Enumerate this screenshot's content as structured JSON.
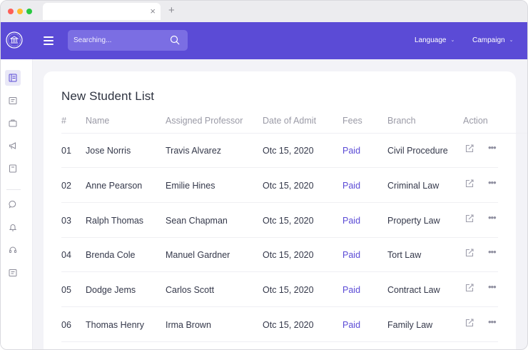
{
  "browser": {
    "tab_close": "×",
    "new_tab": "+"
  },
  "topbar": {
    "search_placeholder": "Searching...",
    "language_label": "Language",
    "campaign_label": "Campaign",
    "caret": "⌄",
    "accent_color": "#5b4bd6"
  },
  "sidebar": {
    "top_icons": [
      "dashboard-icon",
      "courses-icon",
      "briefcase-icon",
      "megaphone-icon",
      "book-icon"
    ],
    "bottom_icons": [
      "chat-icon",
      "bell-icon",
      "headset-icon",
      "courses-icon"
    ]
  },
  "students": {
    "title": "New Student List",
    "columns": [
      "#",
      "Name",
      "Assigned Professor",
      "Date of Admit",
      "Fees",
      "Branch",
      "Action"
    ],
    "rows": [
      {
        "num": "01",
        "name": "Jose Norris",
        "professor": "Travis Alvarez",
        "date": "Otc 15, 2020",
        "fees": "Paid",
        "branch": "Civil Procedure"
      },
      {
        "num": "02",
        "name": "Anne Pearson",
        "professor": "Emilie Hines",
        "date": "Otc 15, 2020",
        "fees": "Paid",
        "branch": "Criminal Law"
      },
      {
        "num": "03",
        "name": "Ralph Thomas",
        "professor": "Sean Chapman",
        "date": "Otc 15, 2020",
        "fees": "Paid",
        "branch": "Property Law"
      },
      {
        "num": "04",
        "name": "Brenda Cole",
        "professor": "Manuel Gardner",
        "date": "Otc 15, 2020",
        "fees": "Paid",
        "branch": "Tort Law"
      },
      {
        "num": "05",
        "name": "Dodge Jems",
        "professor": "Carlos Scott",
        "date": "Otc 15, 2020",
        "fees": "Paid",
        "branch": "Contract Law"
      },
      {
        "num": "06",
        "name": "Thomas Henry",
        "professor": "Irma Brown",
        "date": "Otc 15, 2020",
        "fees": "Paid",
        "branch": "Family Law"
      }
    ],
    "more_glyph": "•••"
  }
}
